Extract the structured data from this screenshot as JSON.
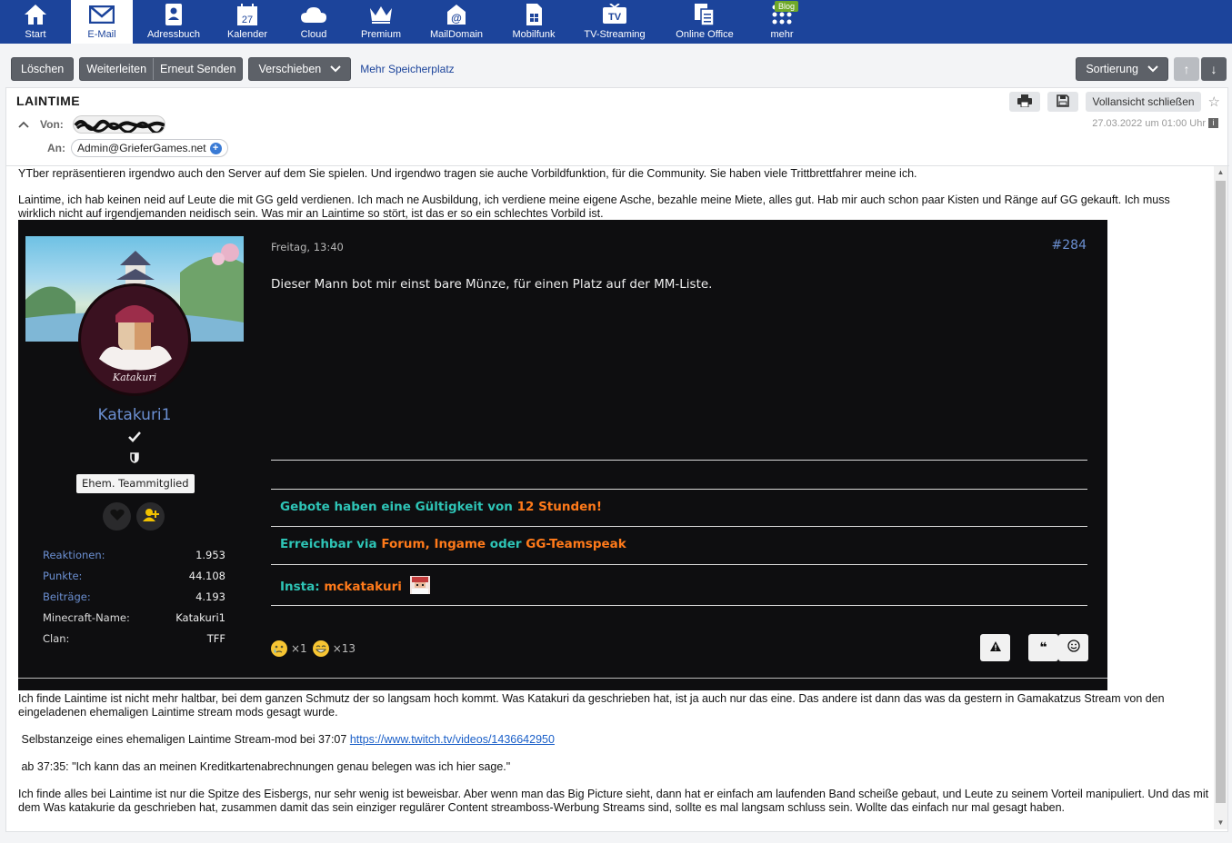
{
  "nav": {
    "items": [
      {
        "label": "Start",
        "icon": "home-icon"
      },
      {
        "label": "E-Mail",
        "icon": "mail-icon"
      },
      {
        "label": "Adressbuch",
        "icon": "addressbook-icon"
      },
      {
        "label": "Kalender",
        "icon": "calendar-icon",
        "icon_text": "27"
      },
      {
        "label": "Cloud",
        "icon": "cloud-icon"
      },
      {
        "label": "Premium",
        "icon": "crown-icon"
      },
      {
        "label": "MailDomain",
        "icon": "maildomain-icon"
      },
      {
        "label": "Mobilfunk",
        "icon": "sim-icon"
      },
      {
        "label": "TV-Streaming",
        "icon": "tv-icon",
        "icon_text": "TV"
      },
      {
        "label": "Online Office",
        "icon": "office-icon"
      },
      {
        "label": "mehr",
        "icon": "grid-icon",
        "badge": "Blog"
      }
    ],
    "active_index": 1
  },
  "toolbar": {
    "delete": "Löschen",
    "forward": "Weiterleiten",
    "resend": "Erneut Senden",
    "move": "Verschieben",
    "more_storage": "Mehr Speicherplatz",
    "sort": "Sortierung"
  },
  "mail": {
    "subject": "LAINTIME",
    "from_label": "Von:",
    "to_label": "An:",
    "to_address": "Admin@GrieferGames.net",
    "date": "27.03.2022 um 01:00 Uhr",
    "close_fullview": "Vollansicht schließen",
    "para1": "YTber repräsentieren irgendwo auch den Server auf dem Sie spielen. Und irgendwo tragen sie auche Vorbildfunktion, für die Community. Sie haben viele Trittbrettfahrer meine ich.",
    "para2": "Laintime, ich hab keinen neid auf Leute die mit GG geld verdienen. Ich mach ne Ausbildung, ich verdiene meine eigene Asche, bezahle meine Miete, alles gut. Hab mir auch schon paar Kisten und Ränge auf GG gekauft. Ich muss wirklich nicht auf irgendjemanden neidisch sein. Was mir an Laintime so stört, ist das er so ein schlechtes Vorbild ist.",
    "para3": "Ich finde Laintime ist nicht mehr haltbar, bei dem ganzen Schmutz der so langsam hoch kommt. Was Katakuri da geschrieben hat, ist ja auch nur das eine. Das andere ist dann das was da gestern in Gamakatzus Stream von den eingeladenen ehemaligen Laintime stream mods gesagt wurde.",
    "para4_prefix": " Selbstanzeige eines ehemaligen Laintime Stream-mod bei 37:07 ",
    "para4_link": "https://www.twitch.tv/videos/1436642950",
    "para5": " ab 37:35: \"Ich kann das an meinen Kreditkartenabrechnungen genau belegen was ich hier sage.\"",
    "para6": "Ich finde alles bei Laintime ist nur die Spitze des Eisbergs, nur sehr wenig ist beweisbar. Aber wenn man das Big Picture sieht, dann hat er einfach am laufenden Band scheiße gebaut, und Leute zu seinem Vorteil manipuliert. Und das mit dem Was katakurie da geschrieben hat, zusammen damit das sein einziger regulärer Content streamboss-Werbung Streams sind, sollte es mal langsam schluss sein. Wollte das einfach nur mal gesagt haben."
  },
  "forum": {
    "username": "Katakuri1",
    "avatar_text": "Katakuri",
    "role_badge": "Ehem. Teammitglied",
    "stats": [
      {
        "key": "Reaktionen:",
        "value": "1.953"
      },
      {
        "key": "Punkte:",
        "value": "44.108"
      },
      {
        "key": "Beiträge:",
        "value": "4.193"
      },
      {
        "key": "Minecraft-Name:",
        "value": "Katakuri1"
      },
      {
        "key": "Clan:",
        "value": "TFF"
      }
    ],
    "post_date": "Freitag, 13:40",
    "post_id": "#284",
    "post_text": "Dieser Mann bot mir einst bare Münze, für einen Platz auf der MM-Liste.",
    "sig1_a": "Gebote haben eine Gültigkeit von ",
    "sig1_b": "12 Stunden!",
    "sig2_a": "Erreichbar via ",
    "sig2_b": "Forum",
    "sig2_c": ", ",
    "sig2_d": "Ingame",
    "sig2_e": " oder ",
    "sig2_f": "GG-Teamspeak",
    "sig3_a": "Insta: ",
    "sig3_b": "mckatakuri",
    "reaction1_count": "×1",
    "reaction2_count": "×13",
    "colors": {
      "accent_blue": "#6b8fd1",
      "teal": "#2ec4b6",
      "orange": "#ff7a1a"
    }
  }
}
